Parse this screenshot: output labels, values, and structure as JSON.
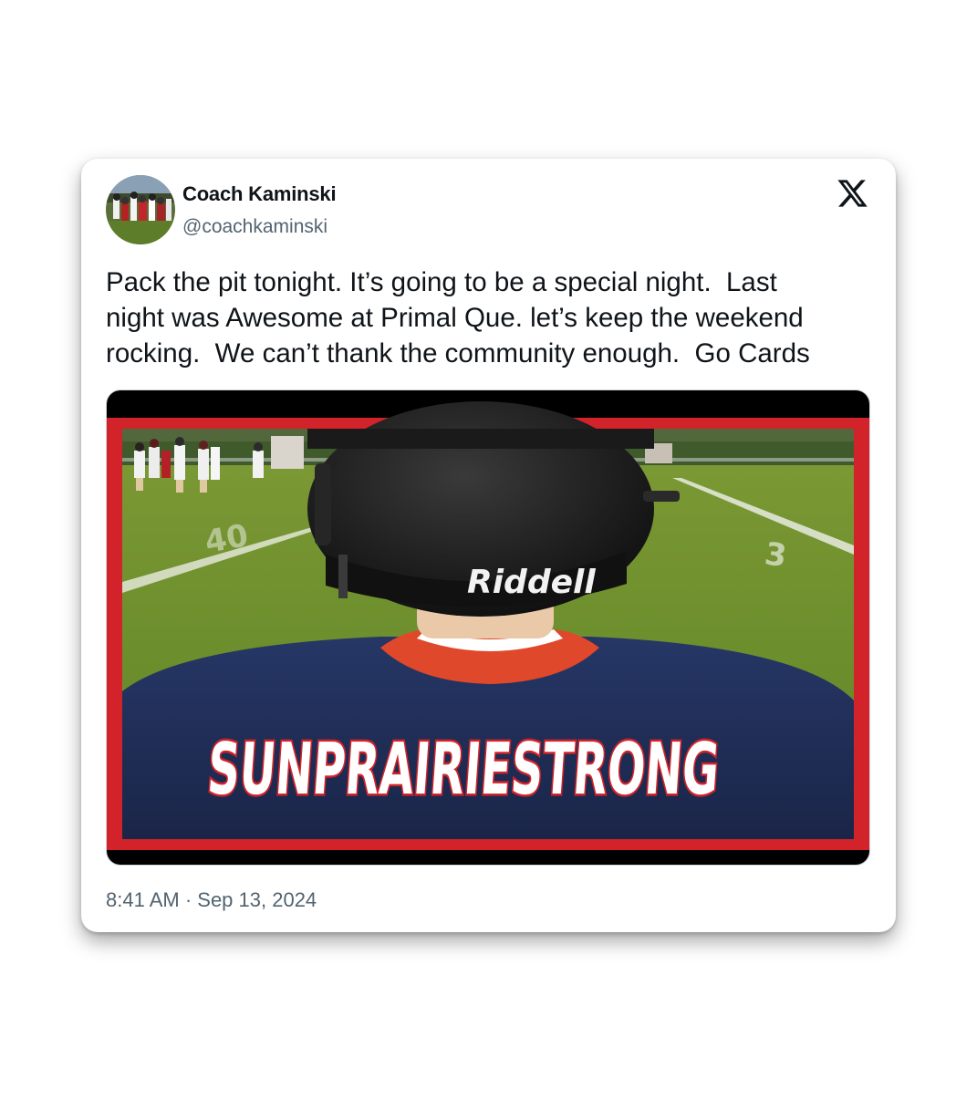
{
  "tweet": {
    "author_name": "Coach Kaminski",
    "author_handle": "@coachkaminski",
    "text": "Pack the pit tonight. It’s going to be a special night.  Last\nnight was Awesome at Primal Que. let’s keep the weekend\nrocking.  We can’t thank the community enough.  Go Cards",
    "timestamp": "8:41 AM · Sep 13, 2024"
  },
  "media": {
    "helmet_brand": "Riddell",
    "jersey_text": "SUNPRAIRIESTRONG",
    "field_number_left": "40",
    "field_number_right": "3"
  },
  "icons": {
    "platform": "x-logo-icon",
    "avatar": "avatar-photo"
  },
  "colors": {
    "text_primary": "#0f1419",
    "text_secondary": "#536471",
    "media_border_red": "#d2232a",
    "jersey_navy": "#1e2c55",
    "field_green": "#6d8f2c"
  }
}
